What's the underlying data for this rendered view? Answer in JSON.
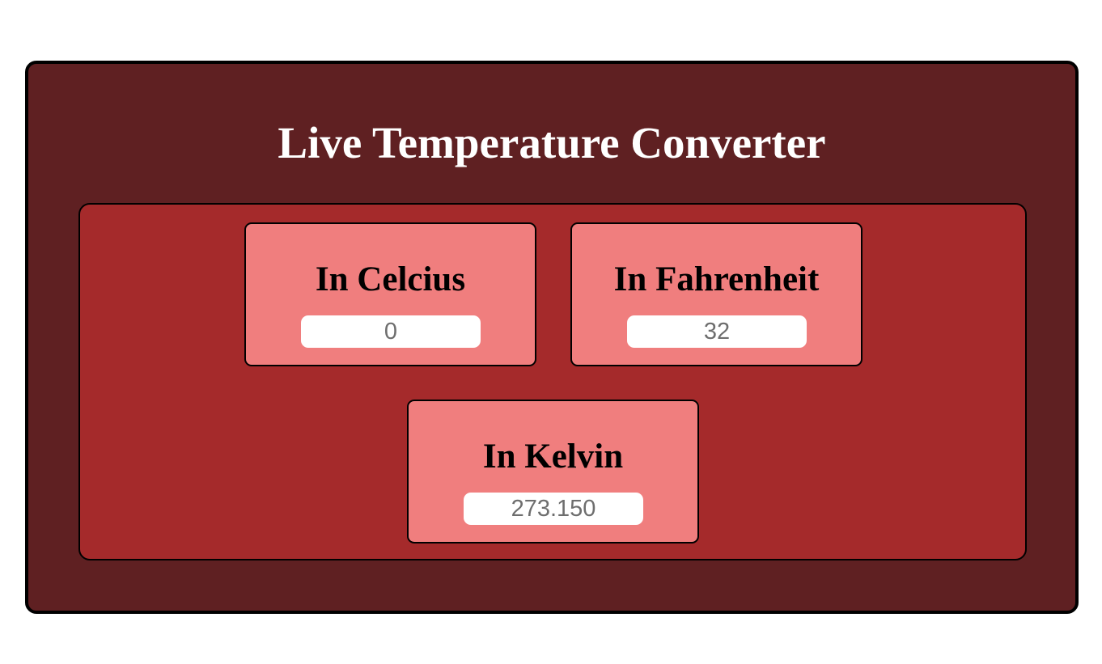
{
  "app": {
    "title": "Live Temperature Converter"
  },
  "converters": [
    {
      "label": "In Celcius",
      "value": "0"
    },
    {
      "label": "In Fahrenheit",
      "value": "32"
    },
    {
      "label": "In Kelvin",
      "value": "273.150"
    }
  ],
  "colors": {
    "page_background": "#ffffff",
    "outer_panel": "#5f2022",
    "inner_panel": "#a52a2b",
    "card": "#f07e7e",
    "input": "#ffffff",
    "title_text": "#ffffff",
    "label_text": "#000000",
    "input_text": "#6e6e6e"
  }
}
